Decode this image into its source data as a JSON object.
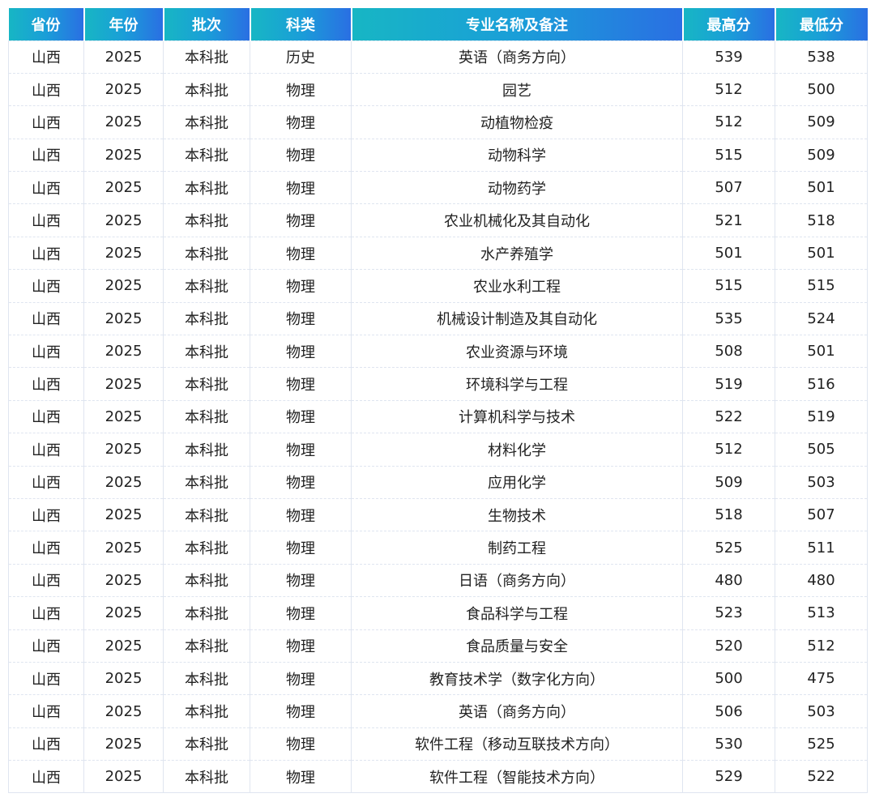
{
  "headers": [
    "省份",
    "年份",
    "批次",
    "科类",
    "专业名称及备注",
    "最高分",
    "最低分"
  ],
  "rows": [
    [
      "山西",
      "2025",
      "本科批",
      "历史",
      "英语（商务方向）",
      "539",
      "538"
    ],
    [
      "山西",
      "2025",
      "本科批",
      "物理",
      "园艺",
      "512",
      "500"
    ],
    [
      "山西",
      "2025",
      "本科批",
      "物理",
      "动植物检疫",
      "512",
      "509"
    ],
    [
      "山西",
      "2025",
      "本科批",
      "物理",
      "动物科学",
      "515",
      "509"
    ],
    [
      "山西",
      "2025",
      "本科批",
      "物理",
      "动物药学",
      "507",
      "501"
    ],
    [
      "山西",
      "2025",
      "本科批",
      "物理",
      "农业机械化及其自动化",
      "521",
      "518"
    ],
    [
      "山西",
      "2025",
      "本科批",
      "物理",
      "水产养殖学",
      "501",
      "501"
    ],
    [
      "山西",
      "2025",
      "本科批",
      "物理",
      "农业水利工程",
      "515",
      "515"
    ],
    [
      "山西",
      "2025",
      "本科批",
      "物理",
      "机械设计制造及其自动化",
      "535",
      "524"
    ],
    [
      "山西",
      "2025",
      "本科批",
      "物理",
      "农业资源与环境",
      "508",
      "501"
    ],
    [
      "山西",
      "2025",
      "本科批",
      "物理",
      "环境科学与工程",
      "519",
      "516"
    ],
    [
      "山西",
      "2025",
      "本科批",
      "物理",
      "计算机科学与技术",
      "522",
      "519"
    ],
    [
      "山西",
      "2025",
      "本科批",
      "物理",
      "材料化学",
      "512",
      "505"
    ],
    [
      "山西",
      "2025",
      "本科批",
      "物理",
      "应用化学",
      "509",
      "503"
    ],
    [
      "山西",
      "2025",
      "本科批",
      "物理",
      "生物技术",
      "518",
      "507"
    ],
    [
      "山西",
      "2025",
      "本科批",
      "物理",
      "制药工程",
      "525",
      "511"
    ],
    [
      "山西",
      "2025",
      "本科批",
      "物理",
      "日语（商务方向）",
      "480",
      "480"
    ],
    [
      "山西",
      "2025",
      "本科批",
      "物理",
      "食品科学与工程",
      "523",
      "513"
    ],
    [
      "山西",
      "2025",
      "本科批",
      "物理",
      "食品质量与安全",
      "520",
      "512"
    ],
    [
      "山西",
      "2025",
      "本科批",
      "物理",
      "教育技术学（数字化方向）",
      "500",
      "475"
    ],
    [
      "山西",
      "2025",
      "本科批",
      "物理",
      "英语（商务方向）",
      "506",
      "503"
    ],
    [
      "山西",
      "2025",
      "本科批",
      "物理",
      "软件工程（移动互联技术方向）",
      "530",
      "525"
    ],
    [
      "山西",
      "2025",
      "本科批",
      "物理",
      "软件工程（智能技术方向）",
      "529",
      "522"
    ]
  ],
  "colors": {
    "header_start": "#17b6c4",
    "header_end": "#2a6fe3",
    "border": "#dfe5f0"
  }
}
